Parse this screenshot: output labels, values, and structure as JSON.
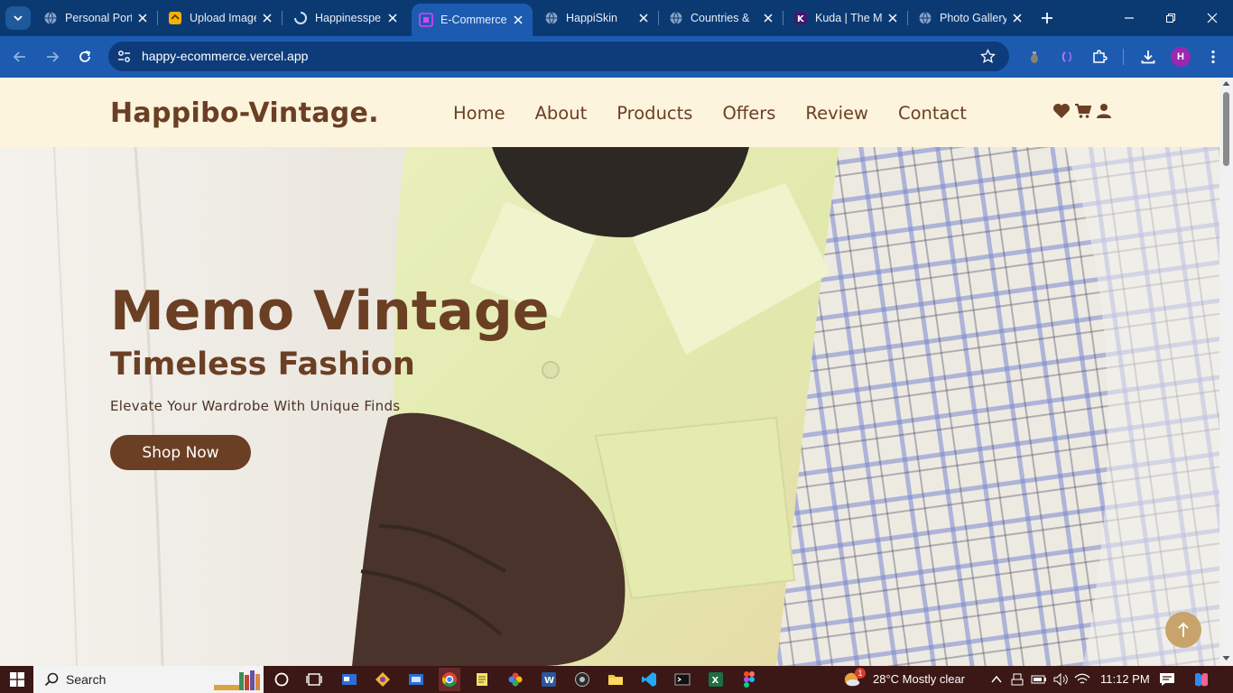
{
  "browser": {
    "tabs": [
      {
        "title": "Personal Portfolio",
        "icon": "globe-icon"
      },
      {
        "title": "Upload Image",
        "icon": "upload-icon"
      },
      {
        "title": "Happinesspe",
        "icon": "loading-icon"
      },
      {
        "title": "E-Commerce",
        "icon": "site-icon",
        "active": true
      },
      {
        "title": "HappiSkin",
        "icon": "globe-icon"
      },
      {
        "title": "Countries & ",
        "icon": "globe-icon"
      },
      {
        "title": "Kuda | The M",
        "icon": "kuda-icon"
      },
      {
        "title": "Photo Gallery",
        "icon": "globe-icon"
      }
    ],
    "url": "happy-ecommerce.vercel.app",
    "profile_initial": "H"
  },
  "site": {
    "brand": "Happibo-Vintage.",
    "nav": [
      "Home",
      "About",
      "Products",
      "Offers",
      "Review",
      "Contact"
    ],
    "hero": {
      "title": "Memo Vintage",
      "subtitle": "Timeless Fashion",
      "tagline": "Elevate Your Wardrobe With Unique Finds",
      "cta": "Shop Now"
    },
    "colors": {
      "brand": "#6b3f24",
      "header_bg": "#fcf4dd",
      "scroll_top": "#c8a46c"
    }
  },
  "taskbar": {
    "search_label": "Search",
    "weather": "28°C  Mostly clear",
    "time": "11:12 PM",
    "weather_badge": "1"
  }
}
